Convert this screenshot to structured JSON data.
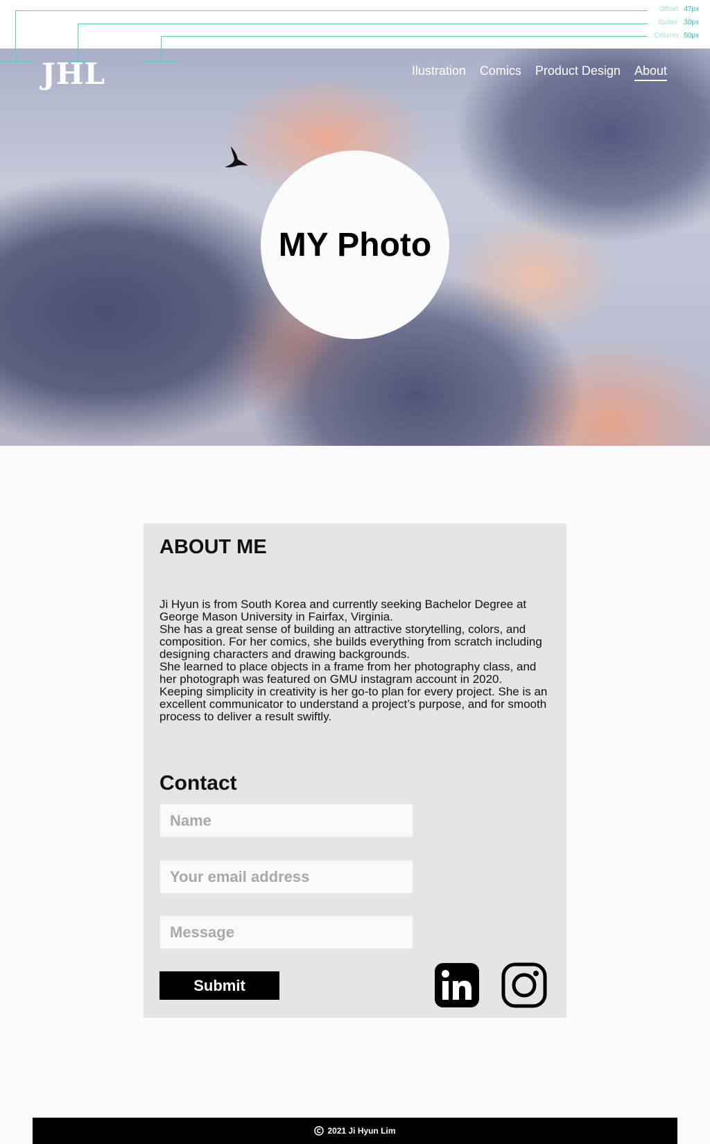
{
  "grid_overlay": {
    "guides": [
      {
        "label": "Offset:",
        "value": "47px"
      },
      {
        "label": "Gutter:",
        "value": "30px"
      },
      {
        "label": "Column:",
        "value": "50px"
      }
    ]
  },
  "header": {
    "logo": "JHL",
    "nav": [
      {
        "label": "Ilustration",
        "active": false
      },
      {
        "label": "Comics",
        "active": false
      },
      {
        "label": "Product Design",
        "active": false
      },
      {
        "label": "About",
        "active": true
      }
    ]
  },
  "hero": {
    "photo_placeholder": "MY Photo"
  },
  "about": {
    "title": "ABOUT ME",
    "paragraphs": [
      "Ji Hyun is from South Korea and currently seeking Bachelor Degree at George Mason University in Fairfax, Virginia.",
      "She has a great sense of building an attractive storytelling, colors, and composition. For her comics, she builds everything from scratch including designing characters and drawing backgrounds.",
      "She learned to place objects in a frame from her photography class, and her photograph was featured on GMU instagram account in 2020.",
      "Keeping simplicity in creativity is her go-to plan for every project. She is an excellent communicator to understand a project’s purpose, and for smooth process to deliver a result swiftly."
    ]
  },
  "contact": {
    "title": "Contact",
    "name_placeholder": "Name",
    "email_placeholder": "Your email address",
    "message_placeholder": "Message",
    "submit_label": "Submit",
    "social": [
      {
        "icon": "linkedin-icon",
        "glyph": "in"
      },
      {
        "icon": "instagram-icon"
      }
    ]
  },
  "footer": {
    "copyright_icon": "copyright-icon",
    "text": "2021 Ji Hyun Lim"
  },
  "colors": {
    "guide": "#5bc8d0",
    "card_bg": "#e5e5e5",
    "button_bg": "#000000",
    "footer_bg": "#000000"
  }
}
